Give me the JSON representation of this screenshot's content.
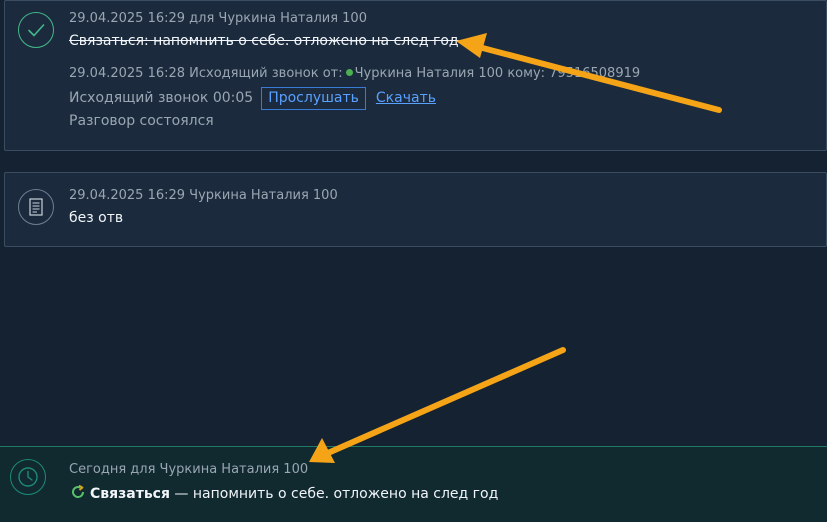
{
  "entries": [
    {
      "timestamp_line": "29.04.2025 16:29  для Чуркина Наталия 100",
      "task_text": "Связаться: напомнить о себе. отложено на след год",
      "call_info_prefix": "29.04.2025 16:28 Исходящий звонок от:",
      "call_info_suffix": "Чуркина Наталия 100 кому: 79516508919",
      "call_duration": "Исходящий звонок 00:05",
      "listen_label": "Прослушать",
      "download_label": "Скачать",
      "call_result": "Разговор состоялся",
      "icon": "check-icon"
    },
    {
      "timestamp_line": "29.04.2025 16:29 Чуркина Наталия 100",
      "note_text": "без отв",
      "icon": "document-icon"
    }
  ],
  "task": {
    "header": "Сегодня для Чуркина Наталия 100",
    "type_label": "Связаться",
    "text": " — напомнить о себе. отложено на след год",
    "icon": "clock-icon",
    "status_icon": "refresh-icon"
  },
  "colors": {
    "background": "#152232",
    "card": "#1b2b3d",
    "accent_green": "#43b88a",
    "link_blue": "#5aa0ff",
    "annotation_arrow": "#f5a417"
  }
}
